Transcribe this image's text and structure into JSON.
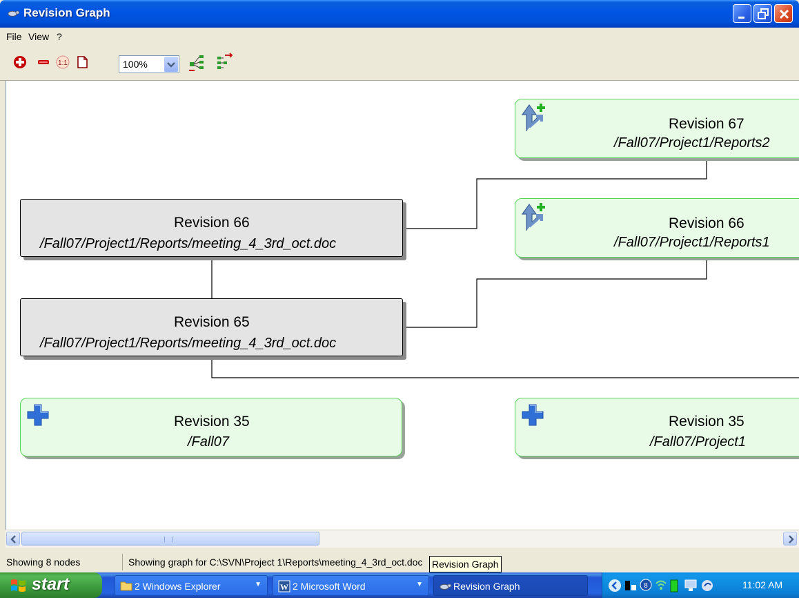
{
  "window": {
    "title": "Revision Graph"
  },
  "menu": {
    "file": "File",
    "view": "View",
    "help": "?"
  },
  "toolbar": {
    "zoom_value": "100%",
    "icons": [
      "zoom-in-icon",
      "zoom-out-icon",
      "zoom-1to1-icon",
      "fit-page-icon",
      "arrange-vertical-icon",
      "arrange-horizontal-icon"
    ]
  },
  "graph": {
    "nodes": [
      {
        "revision": "Revision 66",
        "path": "/Fall07/Project1/Reports/meeting_4_3rd_oct.doc",
        "kind": "modified"
      },
      {
        "revision": "Revision 65",
        "path": "/Fall07/Project1/Reports/meeting_4_3rd_oct.doc",
        "kind": "modified"
      },
      {
        "revision": "Revision 35",
        "path": "/Fall07",
        "kind": "added"
      },
      {
        "revision": "Revision 67",
        "path": "/Fall07/Project1/Reports2",
        "kind": "copied"
      },
      {
        "revision": "Revision 66",
        "path": "/Fall07/Project1/Reports1",
        "kind": "copied"
      },
      {
        "revision": "Revision 35",
        "path": "/Fall07/Project1",
        "kind": "added"
      }
    ]
  },
  "status": {
    "nodes_text": "Showing 8 nodes",
    "path_text": "Showing graph for C:\\SVN\\Project 1\\Reports\\meeting_4_3rd_oct.doc",
    "tooltip": "Revision Graph"
  },
  "taskbar": {
    "start": "start",
    "tasks": [
      {
        "label": "2 Windows Explorer"
      },
      {
        "label": "2 Microsoft Word"
      },
      {
        "label": "Revision Graph"
      }
    ],
    "clock": "11:02 AM"
  },
  "colors": {
    "titlebar": "#0054e3",
    "node_gray": "#e4e4e4",
    "node_green": "#e7fbe7",
    "node_green_border": "#55d455",
    "icon_blue": "#2f6fd6"
  }
}
